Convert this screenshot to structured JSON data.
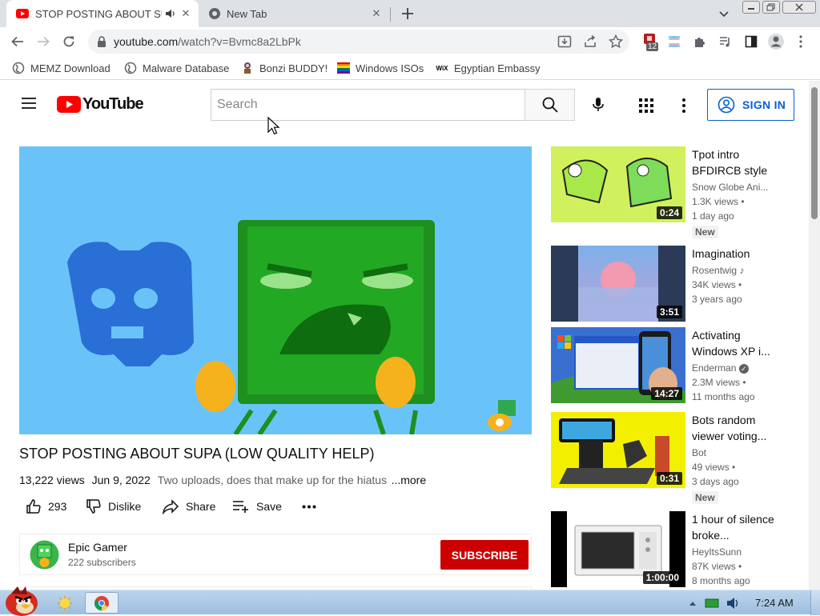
{
  "browser": {
    "tabs": [
      {
        "title": "STOP POSTING ABOUT SUPA (LOW QUALITY HELP) - YouTube",
        "active": true,
        "audio": true
      },
      {
        "title": "New Tab",
        "active": false
      }
    ],
    "address": {
      "host": "youtube.com",
      "path": "/watch?v=Bvmc8a2LbPk"
    },
    "extension_badge": "12",
    "bookmarks": [
      {
        "label": "MEMZ Download",
        "icon": "globe-icon"
      },
      {
        "label": "Malware Database",
        "icon": "globe-icon"
      },
      {
        "label": "Bonzi BUDDY!",
        "icon": "bonzi-icon"
      },
      {
        "label": "Windows ISOs",
        "icon": "rainbow-flag-icon"
      },
      {
        "label": "Egyptian Embassy",
        "icon": "wix-icon"
      }
    ]
  },
  "youtube": {
    "logo_text": "YouTube",
    "search": {
      "placeholder": "Search"
    },
    "sign_in": "SIGN IN",
    "video": {
      "title": "STOP POSTING ABOUT SUPA (LOW QUALITY HELP)",
      "views": "13,222 views",
      "date": "Jun 9, 2022",
      "description": "Two uploads, does that make up for the hiatus",
      "more": "...more",
      "likes": "293",
      "dislike": "Dislike",
      "share": "Share",
      "save": "Save"
    },
    "channel": {
      "name": "Epic Gamer",
      "subscribers": "222 subscribers",
      "subscribe": "SUBSCRIBE"
    },
    "recommendations": [
      {
        "title": "Tpot intro BFDIRCB style",
        "channel": "Snow Globe Ani...",
        "views": "1.3K views",
        "age": "1 day ago",
        "badge": "New",
        "duration": "0:24"
      },
      {
        "title": "Imagination",
        "channel": "Rosentwig",
        "views": "34K views",
        "age": "3 years ago",
        "duration": "3:51"
      },
      {
        "title": "Activating Windows XP i...",
        "channel": "Enderman",
        "views": "2.3M views",
        "age": "11 months ago",
        "duration": "14:27"
      },
      {
        "title": "Bots random viewer voting...",
        "channel": "Bot",
        "views": "49 views",
        "age": "3 days ago",
        "badge": "New",
        "duration": "0:31"
      },
      {
        "title": "1 hour of silence broke...",
        "channel": "HeyItsSunn",
        "views": "87K views",
        "age": "8 months ago",
        "duration": "1:00:00"
      }
    ]
  },
  "taskbar": {
    "clock": "7:24 AM"
  },
  "colors": {
    "youtube_red": "#ff0000",
    "subscribe_red": "#cc0000",
    "link_blue": "#065fd4",
    "chrome_frame": "#dee1e6"
  }
}
